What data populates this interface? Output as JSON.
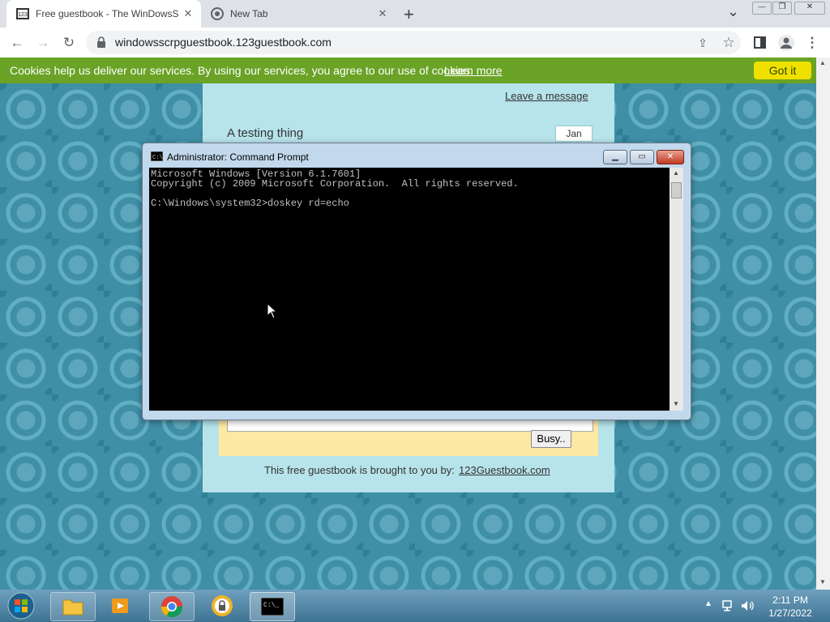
{
  "browser": {
    "tabs": [
      {
        "title": "Free guestbook - The WinDowsS",
        "active": true
      },
      {
        "title": "New Tab",
        "active": false
      }
    ],
    "url": "windowsscrpguestbook.123guestbook.com",
    "new_tab_label": "+",
    "tab_list_label": "⌄",
    "window_min": "—",
    "window_restore": "❐",
    "window_close": "✕"
  },
  "cookie_bar": {
    "text": "Cookies help us deliver our services. By using our services, you agree to our use of cookies.",
    "learn_more": "Learn more",
    "got_it": "Got it"
  },
  "guestbook": {
    "leave_message": "Leave a message",
    "entry_title": "A testing thing",
    "entry_month": "Jan",
    "message_text": "",
    "busy_button": "Busy..",
    "footer_text": "This free guestbook is brought to you by:",
    "footer_link": "123Guestbook.com"
  },
  "cmd": {
    "title": "Administrator: Command Prompt",
    "lines": [
      "Microsoft Windows [Version 6.1.7601]",
      "Copyright (c) 2009 Microsoft Corporation.  All rights reserved.",
      "",
      "C:\\Windows\\system32>doskey rd=echo"
    ]
  },
  "taskbar": {
    "time": "2:11 PM",
    "date": "1/27/2022"
  },
  "colors": {
    "cookie_green": "#6aa326",
    "got_it_yellow": "#f0e000",
    "content_bg": "#b7e3ea",
    "form_bg": "#fde9a4"
  }
}
